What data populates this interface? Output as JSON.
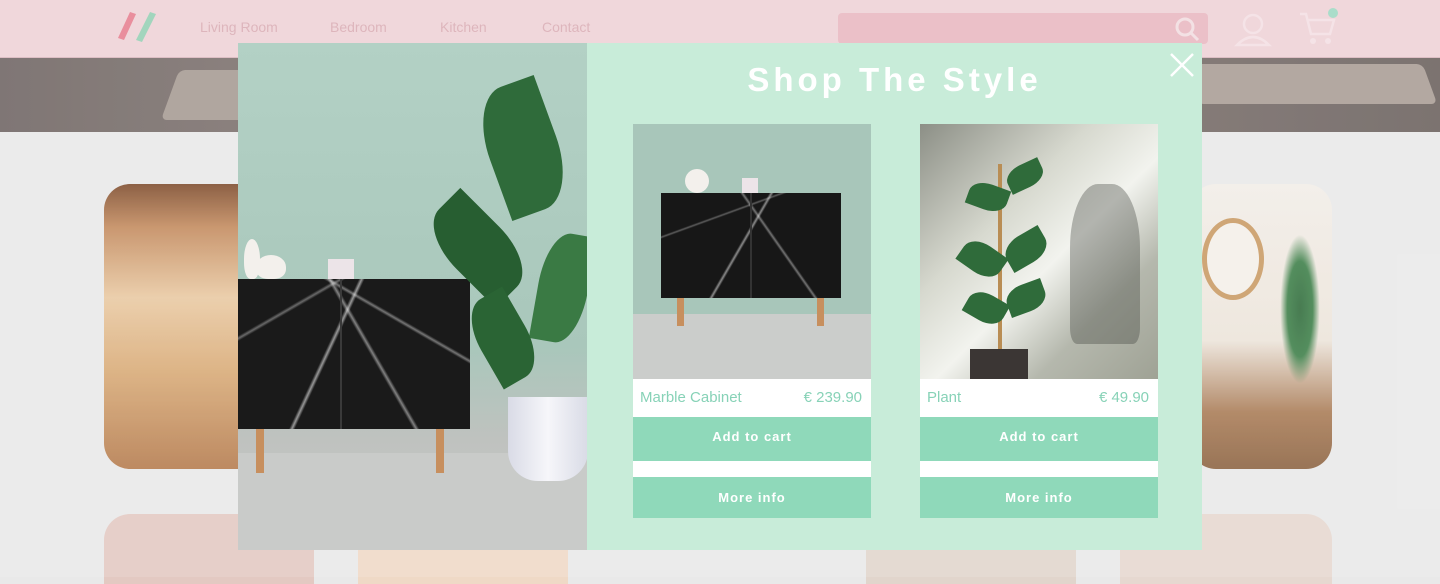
{
  "nav": {
    "links": [
      "Living Room",
      "Bedroom",
      "Kitchen",
      "Contact"
    ]
  },
  "modal": {
    "title": "Shop The Style",
    "close_icon": "close-icon",
    "products": [
      {
        "name": "Marble Cabinet",
        "price": "€ 239.90",
        "add_to_cart": "Add to cart",
        "more_info": "More info"
      },
      {
        "name": "Plant",
        "price": "€ 49.90",
        "add_to_cart": "Add to cart",
        "more_info": "More info"
      }
    ]
  },
  "colors": {
    "nav_bg": "#eed2d6",
    "modal_bg": "#c8ecd9",
    "button_bg": "#8fd9ba",
    "price_text": "#87d2b7"
  }
}
